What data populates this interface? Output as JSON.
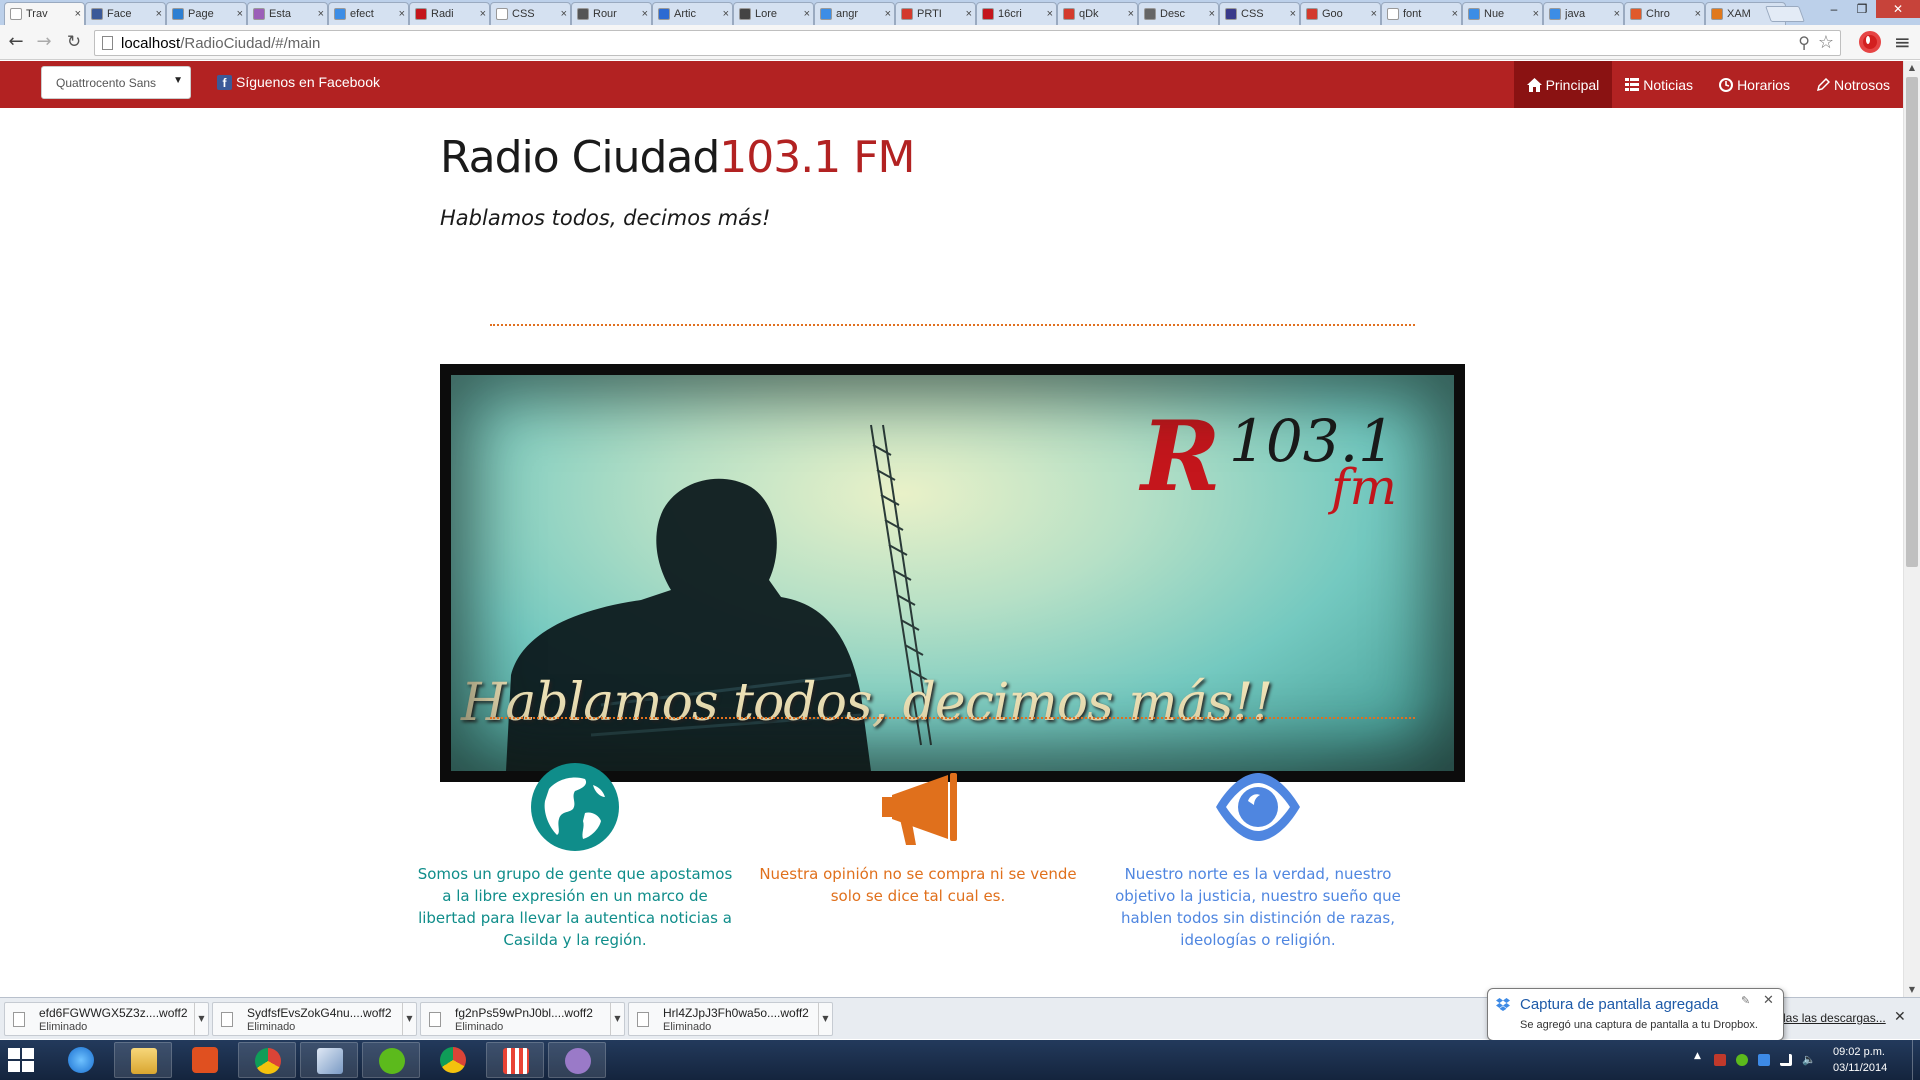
{
  "browser": {
    "tabs": [
      {
        "label": "Trav",
        "favicon_color": "#ffffff",
        "active": true
      },
      {
        "label": "Face",
        "favicon_color": "#3b5998"
      },
      {
        "label": "Page",
        "favicon_color": "#2d7fd2"
      },
      {
        "label": "Esta",
        "favicon_color": "#9b5fb8"
      },
      {
        "label": "efect",
        "favicon_color": "#3c8de6"
      },
      {
        "label": "Radi",
        "favicon_color": "#c4161c"
      },
      {
        "label": "CSS",
        "favicon_color": "#ffffff"
      },
      {
        "label": "Rour",
        "favicon_color": "#555555"
      },
      {
        "label": "Artic",
        "favicon_color": "#2d6ad2"
      },
      {
        "label": "Lore",
        "favicon_color": "#444444"
      },
      {
        "label": "angr",
        "favicon_color": "#3c8de6"
      },
      {
        "label": "PRTI",
        "favicon_color": "#d33a2c"
      },
      {
        "label": "16cri",
        "favicon_color": "#c4161c"
      },
      {
        "label": "qDk",
        "favicon_color": "#d33a2c"
      },
      {
        "label": "Desc",
        "favicon_color": "#666666"
      },
      {
        "label": "CSS",
        "favicon_color": "#3a3a8a"
      },
      {
        "label": "Goo",
        "favicon_color": "#d33a2c"
      },
      {
        "label": "font",
        "favicon_color": "#ffffff"
      },
      {
        "label": "Nue",
        "favicon_color": "#3c8de6"
      },
      {
        "label": "java",
        "favicon_color": "#3c8de6"
      },
      {
        "label": "Chro",
        "favicon_color": "#e05a2a"
      },
      {
        "label": "XAM",
        "favicon_color": "#e0781c"
      }
    ],
    "tab_close_glyph": "×",
    "url": {
      "host": "localhost",
      "path": "/RadioCiudad/#/main"
    }
  },
  "site": {
    "nav": {
      "font_select_value": "Quattrocento Sans",
      "facebook_link": "Síguenos en Facebook",
      "items": [
        {
          "label": "Principal",
          "icon": "home-icon",
          "active": true
        },
        {
          "label": "Noticias",
          "icon": "list-icon"
        },
        {
          "label": "Horarios",
          "icon": "clock-icon"
        },
        {
          "label": "Notrosos",
          "icon": "pencil-icon"
        }
      ]
    },
    "title": "Radio Ciudad",
    "title_freq": "103.1 FM",
    "slogan": "Hablamos todos, decimos más!",
    "banner": {
      "logo_letter": "R",
      "logo_freq": "103.1",
      "logo_fm": "fm",
      "slogan": "Hablamos todos, decimos más!!"
    },
    "features": [
      {
        "icon": "globe-icon",
        "color": "#0f8d8a",
        "text": "Somos un grupo de gente que apostamos a la libre expresión en un marco de libertad para llevar la autentica noticias a Casilda y la región."
      },
      {
        "icon": "megaphone-icon",
        "color": "#e0701c",
        "text": "Nuestra opinión no se compra ni se vende solo se dice tal cual es."
      },
      {
        "icon": "eye-icon",
        "color": "#4f86e0",
        "text": "Nuestro norte es la verdad, nuestro objetivo la justicia, nuestro sueño que hablen todos sin distinción de razas, ideologías o religión."
      }
    ]
  },
  "downloads": {
    "items": [
      {
        "name": "efd6FGWWGX5Z3z....woff2",
        "status": "Eliminado"
      },
      {
        "name": "SydfsfEvsZokG4nu....woff2",
        "status": "Eliminado"
      },
      {
        "name": "fg2nPs59wPnJ0bl....woff2",
        "status": "Eliminado"
      },
      {
        "name": "Hrl4ZJpJ3Fh0wa5o....woff2",
        "status": "Eliminado"
      }
    ],
    "show_all": "Mostrar todas las descargas..."
  },
  "toast": {
    "title": "Captura de pantalla agregada",
    "body": "Se agregó una captura de pantalla a tu Dropbox."
  },
  "taskbar": {
    "clock_time": "09:02 p.m.",
    "clock_date": "03/11/2014"
  }
}
